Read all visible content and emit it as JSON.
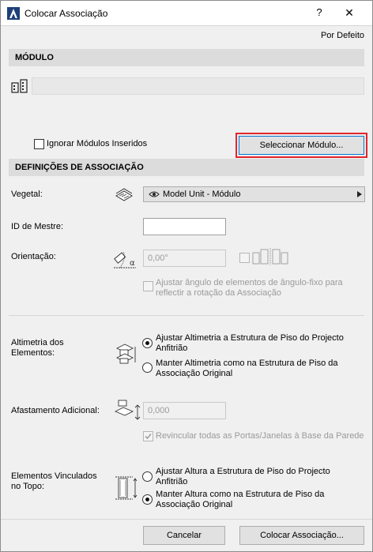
{
  "window": {
    "title": "Colocar Associação",
    "help_label": "?",
    "close_label": "✕"
  },
  "header": {
    "default_link": "Por Defeito"
  },
  "module_section": {
    "title": "MÓDULO",
    "ignore_checkbox_label": "Ignorar Módulos Inseridos",
    "ignore_checked": false,
    "select_button_label": "Seleccionar Módulo..."
  },
  "association_section": {
    "title": "DEFINIÇÕES DE ASSOCIAÇÃO",
    "vegetal_label": "Vegetal:",
    "vegetal_value": "Model Unit - Módulo",
    "master_id_label": "ID de Mestre:",
    "master_id_value": "",
    "orientation_label": "Orientação:",
    "orientation_value": "0,00°",
    "adjust_angle_label_line1": "Ajustar ângulo de elementos de ângulo-fixo para",
    "adjust_angle_label_line2": "reflectir a rotação da Associação",
    "elevation_label_line1": "Altimetria dos",
    "elevation_label_line2": "Elementos:",
    "elevation_option1_line1": "Ajustar Altimetria a Estrutura de Piso do Projecto",
    "elevation_option1_line2": "Anfitrião",
    "elevation_option2_line1": "Manter Altimetria como na Estrutura de Piso da",
    "elevation_option2_line2": "Associação Original",
    "elevation_selected": 1,
    "offset_label": "Afastamento Adicional:",
    "offset_value": "0,000",
    "relink_label": "Revincular todas as Portas/Janelas à Base da Parede",
    "relink_checked": true,
    "top_linked_label_line1": "Elementos Vinculados",
    "top_linked_label_line2": "no Topo:",
    "top_option1_line1": "Ajustar Altura a Estrutura de Piso do Projecto",
    "top_option1_line2": "Anfitrião",
    "top_option2_line1": "Manter Altura como na Estrutura de Piso da",
    "top_option2_line2": "Associação Original",
    "top_selected": 2
  },
  "footer": {
    "cancel_label": "Cancelar",
    "place_label": "Colocar Associação..."
  },
  "colors": {
    "highlight": "#e2262b",
    "focus_border": "#0078d7",
    "section_header_bg": "#dcdcdc"
  },
  "icons": [
    "archicad-app-icon",
    "module-icon",
    "vegetal-layer-icon",
    "eye-icon",
    "arrow-right-icon",
    "orientation-angle-icon",
    "mirror-icon",
    "elevation-icon",
    "offset-icon",
    "top-linked-icon"
  ]
}
